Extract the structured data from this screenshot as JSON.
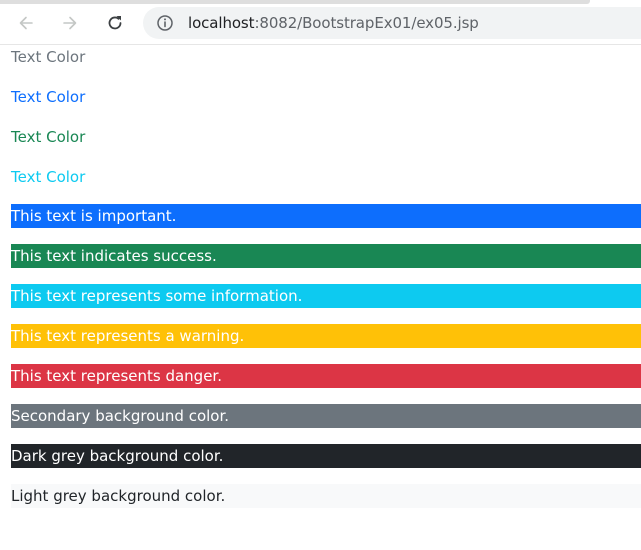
{
  "browser": {
    "url_host": "localhost",
    "url_rest": ":8082/BootstrapEx01/ex05.jsp",
    "icons": {
      "back": "arrow-left-icon",
      "forward": "arrow-right-icon",
      "reload": "reload-icon",
      "info": "info-circle-icon"
    }
  },
  "text_colors": [
    {
      "label": "Text Color",
      "color": "#6c757d"
    },
    {
      "label": "Text Color",
      "color": "#0d6efd"
    },
    {
      "label": "Text Color",
      "color": "#198754"
    },
    {
      "label": "Text Color",
      "color": "#0dcaf0"
    }
  ],
  "backgrounds": [
    {
      "label": "This text is important.",
      "bg": "#0d6efd",
      "fg": "#ffffff"
    },
    {
      "label": "This text indicates success.",
      "bg": "#198754",
      "fg": "#ffffff"
    },
    {
      "label": "This text represents some information.",
      "bg": "#0dcaf0",
      "fg": "#ffffff"
    },
    {
      "label": "This text represents a warning.",
      "bg": "#ffc107",
      "fg": "#ffffff"
    },
    {
      "label": "This text represents danger.",
      "bg": "#dc3545",
      "fg": "#ffffff"
    },
    {
      "label": "Secondary background color.",
      "bg": "#6c757d",
      "fg": "#ffffff"
    },
    {
      "label": "Dark grey background color.",
      "bg": "#212529",
      "fg": "#ffffff"
    },
    {
      "label": "Light grey background color.",
      "bg": "#f8f9fa",
      "fg": "#212529"
    }
  ]
}
